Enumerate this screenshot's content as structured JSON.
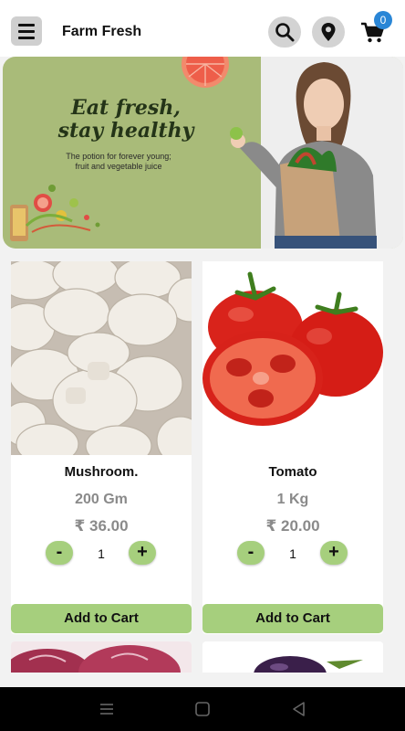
{
  "header": {
    "menu_icon": "hamburger-menu-icon",
    "title": "Farm Fresh",
    "search_icon": "search-icon",
    "location_icon": "location-pin-icon",
    "cart_icon": "cart-icon",
    "cart_count": "0"
  },
  "banner": {
    "title_line1": "Eat fresh,",
    "title_line2": "stay healthy",
    "subtitle_line1": "The potion for forever young;",
    "subtitle_line2": "fruit and vegetable juice"
  },
  "products": [
    {
      "name": "Mushroom.",
      "quantity": "200 Gm",
      "price": "₹ 36.00",
      "count": "1",
      "minus": "-",
      "plus": "+",
      "add_to_cart": "Add to Cart"
    },
    {
      "name": "Tomato",
      "quantity": "1 Kg",
      "price": "₹ 20.00",
      "count": "1",
      "minus": "-",
      "plus": "+",
      "add_to_cart": "Add to Cart"
    }
  ],
  "system_nav": {
    "recents_icon": "recents-icon",
    "home_icon": "home-icon",
    "back_icon": "back-icon"
  },
  "colors": {
    "accent_green": "#a6cf7d",
    "banner_green": "#a9bb79",
    "badge_blue": "#2a86d6",
    "muted_text": "#8a8a8a"
  }
}
